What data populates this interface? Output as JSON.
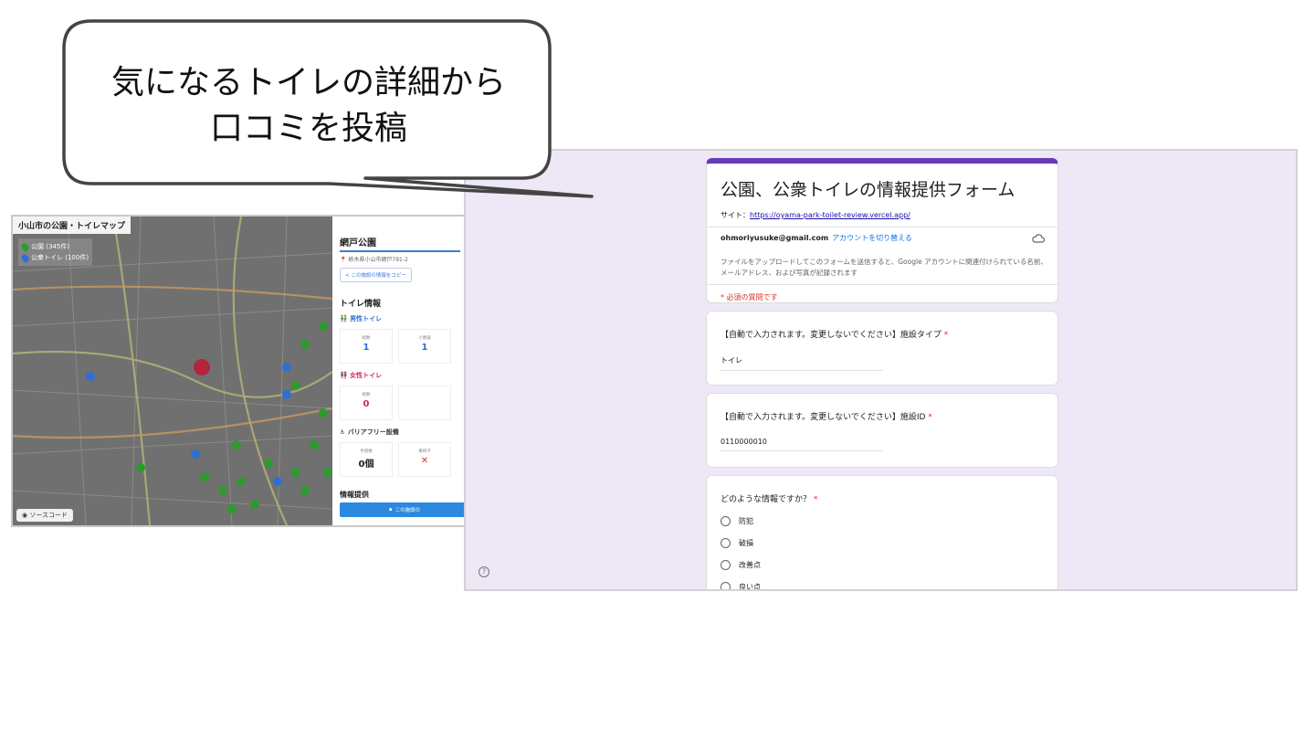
{
  "callout": {
    "line1": "気になるトイレの詳細から",
    "line2": "口コミを投稿"
  },
  "map_app": {
    "title": "小山市の公園・トイレマップ",
    "legend": [
      {
        "label": "公園 (345件)",
        "color": "#2e9a2e"
      },
      {
        "label": "公衆トイレ (100件)",
        "color": "#2f6fd3"
      }
    ],
    "source_button": "ソースコード",
    "panel": {
      "park_name": "網戸公園",
      "address": "栃木県小山市網戸791-2",
      "copy_button": "この施設の情報をコピー",
      "toilet_section": "トイレ情報",
      "male_label": "男性トイレ",
      "male_cells": [
        {
          "label": "総数",
          "value": "1"
        },
        {
          "label": "小便器",
          "value": "1"
        }
      ],
      "female_label": "女性トイレ",
      "female_cells": [
        {
          "label": "総数",
          "value": "0"
        }
      ],
      "barrier_label": "バリアフリー設備",
      "barrier_cells": [
        {
          "label": "手摺数",
          "value": "0個"
        },
        {
          "label": "車椅子",
          "value": "✕"
        }
      ],
      "info_section": "情報提供",
      "post_button": "この施設の"
    }
  },
  "form": {
    "title": "公園、公衆トイレの情報提供フォーム",
    "site_prefix": "サイト：",
    "site_url": "https://oyama-park-toilet-review.vercel.app/",
    "account_email": "ohmoriyusuke@gmail.com",
    "switch_account": "アカウントを切り替える",
    "notice": "ファイルをアップロードしてこのフォームを送信すると、Google アカウントに関連付けられている名前、メールアドレス、および写真が記録されます",
    "required_note": "* 必須の質問です",
    "questions": [
      {
        "title": "【自動で入力されます。変更しないでください】施設タイプ",
        "star": "*",
        "value": "トイレ"
      },
      {
        "title": "【自動で入力されます。変更しないでください】施設ID",
        "star": "*",
        "value": "0110000010"
      }
    ],
    "radio_question": {
      "title": "どのような情報ですか？",
      "star": "*",
      "options": [
        "防犯",
        "破損",
        "改善点",
        "良い点"
      ]
    },
    "accent_color": "#673ab7",
    "background_color": "#ede7f6"
  }
}
